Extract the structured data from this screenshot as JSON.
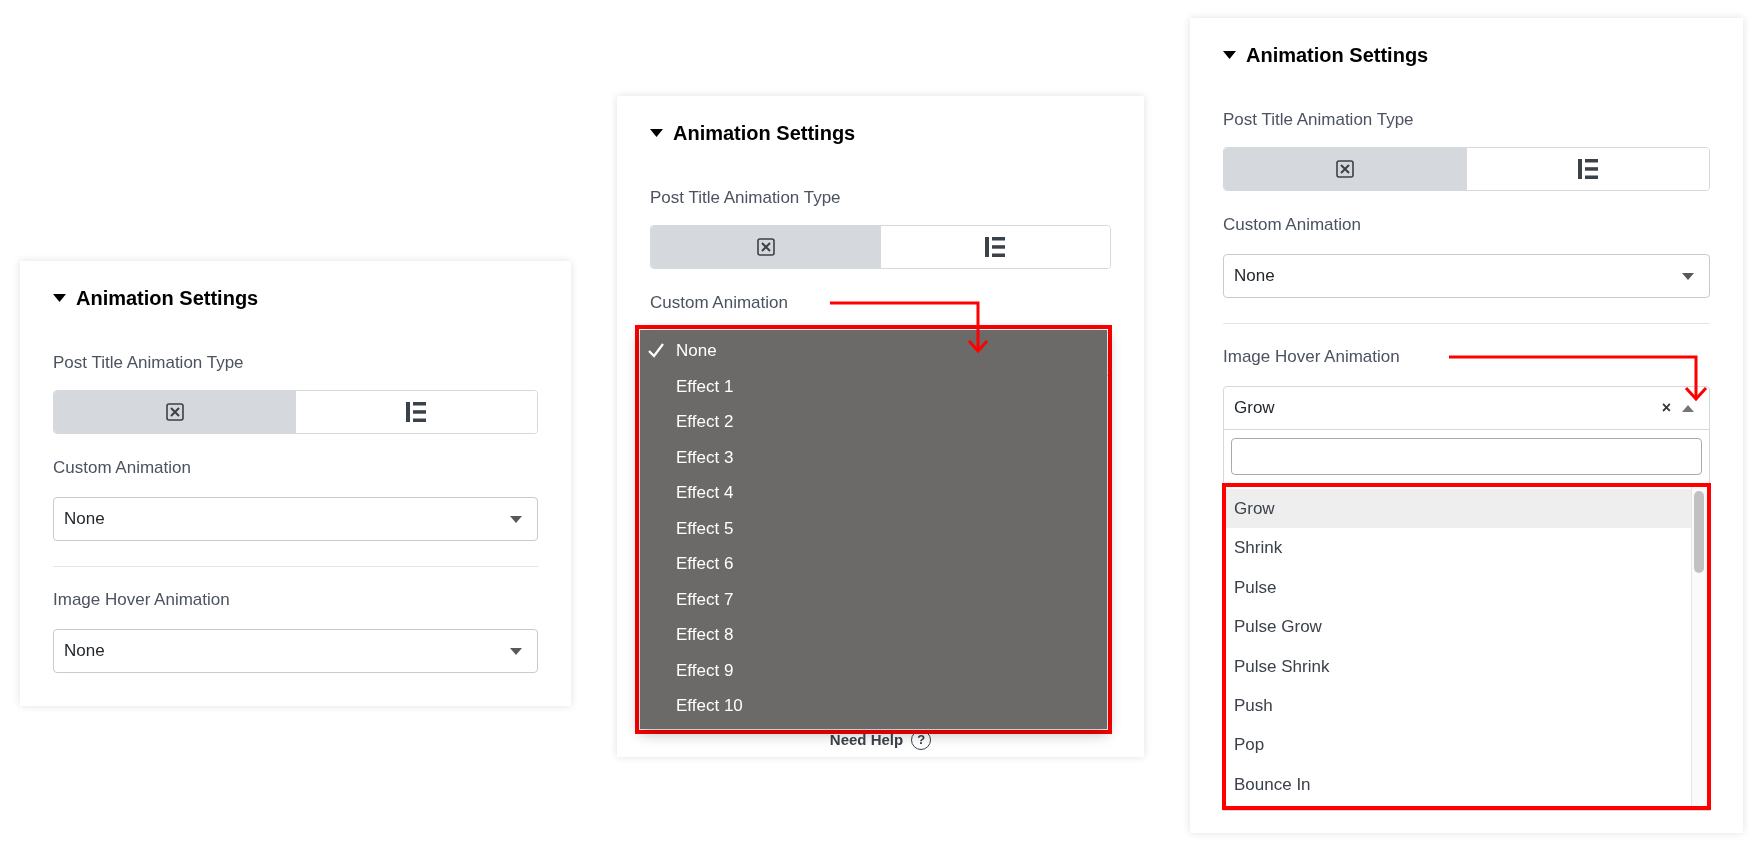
{
  "panels": [
    {
      "title": "Animation Settings",
      "expanded": true,
      "type_field": {
        "label": "Post Title Animation Type",
        "options": [
          {
            "kind": "preset",
            "selected": true
          },
          {
            "kind": "custom",
            "selected": false
          }
        ]
      },
      "fields": [
        {
          "label": "Custom Animation",
          "value": "None"
        },
        {
          "label": "Image Hover Animation",
          "value": "None"
        }
      ]
    },
    {
      "title": "Animation Settings",
      "expanded": true,
      "type_field": {
        "label": "Post Title Animation Type",
        "options": [
          {
            "kind": "preset",
            "selected": true
          },
          {
            "kind": "custom",
            "selected": false
          }
        ]
      },
      "fields": [
        {
          "label": "Custom Animation",
          "annotated": true,
          "menu": {
            "kind": "native",
            "options": [
              {
                "label": "None",
                "selected": true
              },
              {
                "label": "Effect 1",
                "selected": false
              },
              {
                "label": "Effect 2",
                "selected": false
              },
              {
                "label": "Effect 3",
                "selected": false
              },
              {
                "label": "Effect 4",
                "selected": false
              },
              {
                "label": "Effect 5",
                "selected": false
              },
              {
                "label": "Effect 6",
                "selected": false
              },
              {
                "label": "Effect 7",
                "selected": false
              },
              {
                "label": "Effect 8",
                "selected": false
              },
              {
                "label": "Effect 9",
                "selected": false
              },
              {
                "label": "Effect 10",
                "selected": false
              }
            ]
          }
        }
      ],
      "help": {
        "label": "Need Help",
        "glyph": "?"
      }
    },
    {
      "title": "Animation Settings",
      "expanded": true,
      "type_field": {
        "label": "Post Title Animation Type",
        "options": [
          {
            "kind": "preset",
            "selected": true
          },
          {
            "kind": "custom",
            "selected": false
          }
        ]
      },
      "fields": [
        {
          "label": "Custom Animation",
          "value": "None"
        },
        {
          "label": "Image Hover Animation",
          "value": "Grow",
          "clear_glyph": "×",
          "annotated": true,
          "menu": {
            "kind": "search",
            "options": [
              {
                "label": "Grow",
                "selected": true
              },
              {
                "label": "Shrink",
                "selected": false
              },
              {
                "label": "Pulse",
                "selected": false
              },
              {
                "label": "Pulse Grow",
                "selected": false
              },
              {
                "label": "Pulse Shrink",
                "selected": false
              },
              {
                "label": "Push",
                "selected": false
              },
              {
                "label": "Pop",
                "selected": false
              },
              {
                "label": "Bounce In",
                "selected": false
              }
            ]
          }
        }
      ]
    }
  ]
}
